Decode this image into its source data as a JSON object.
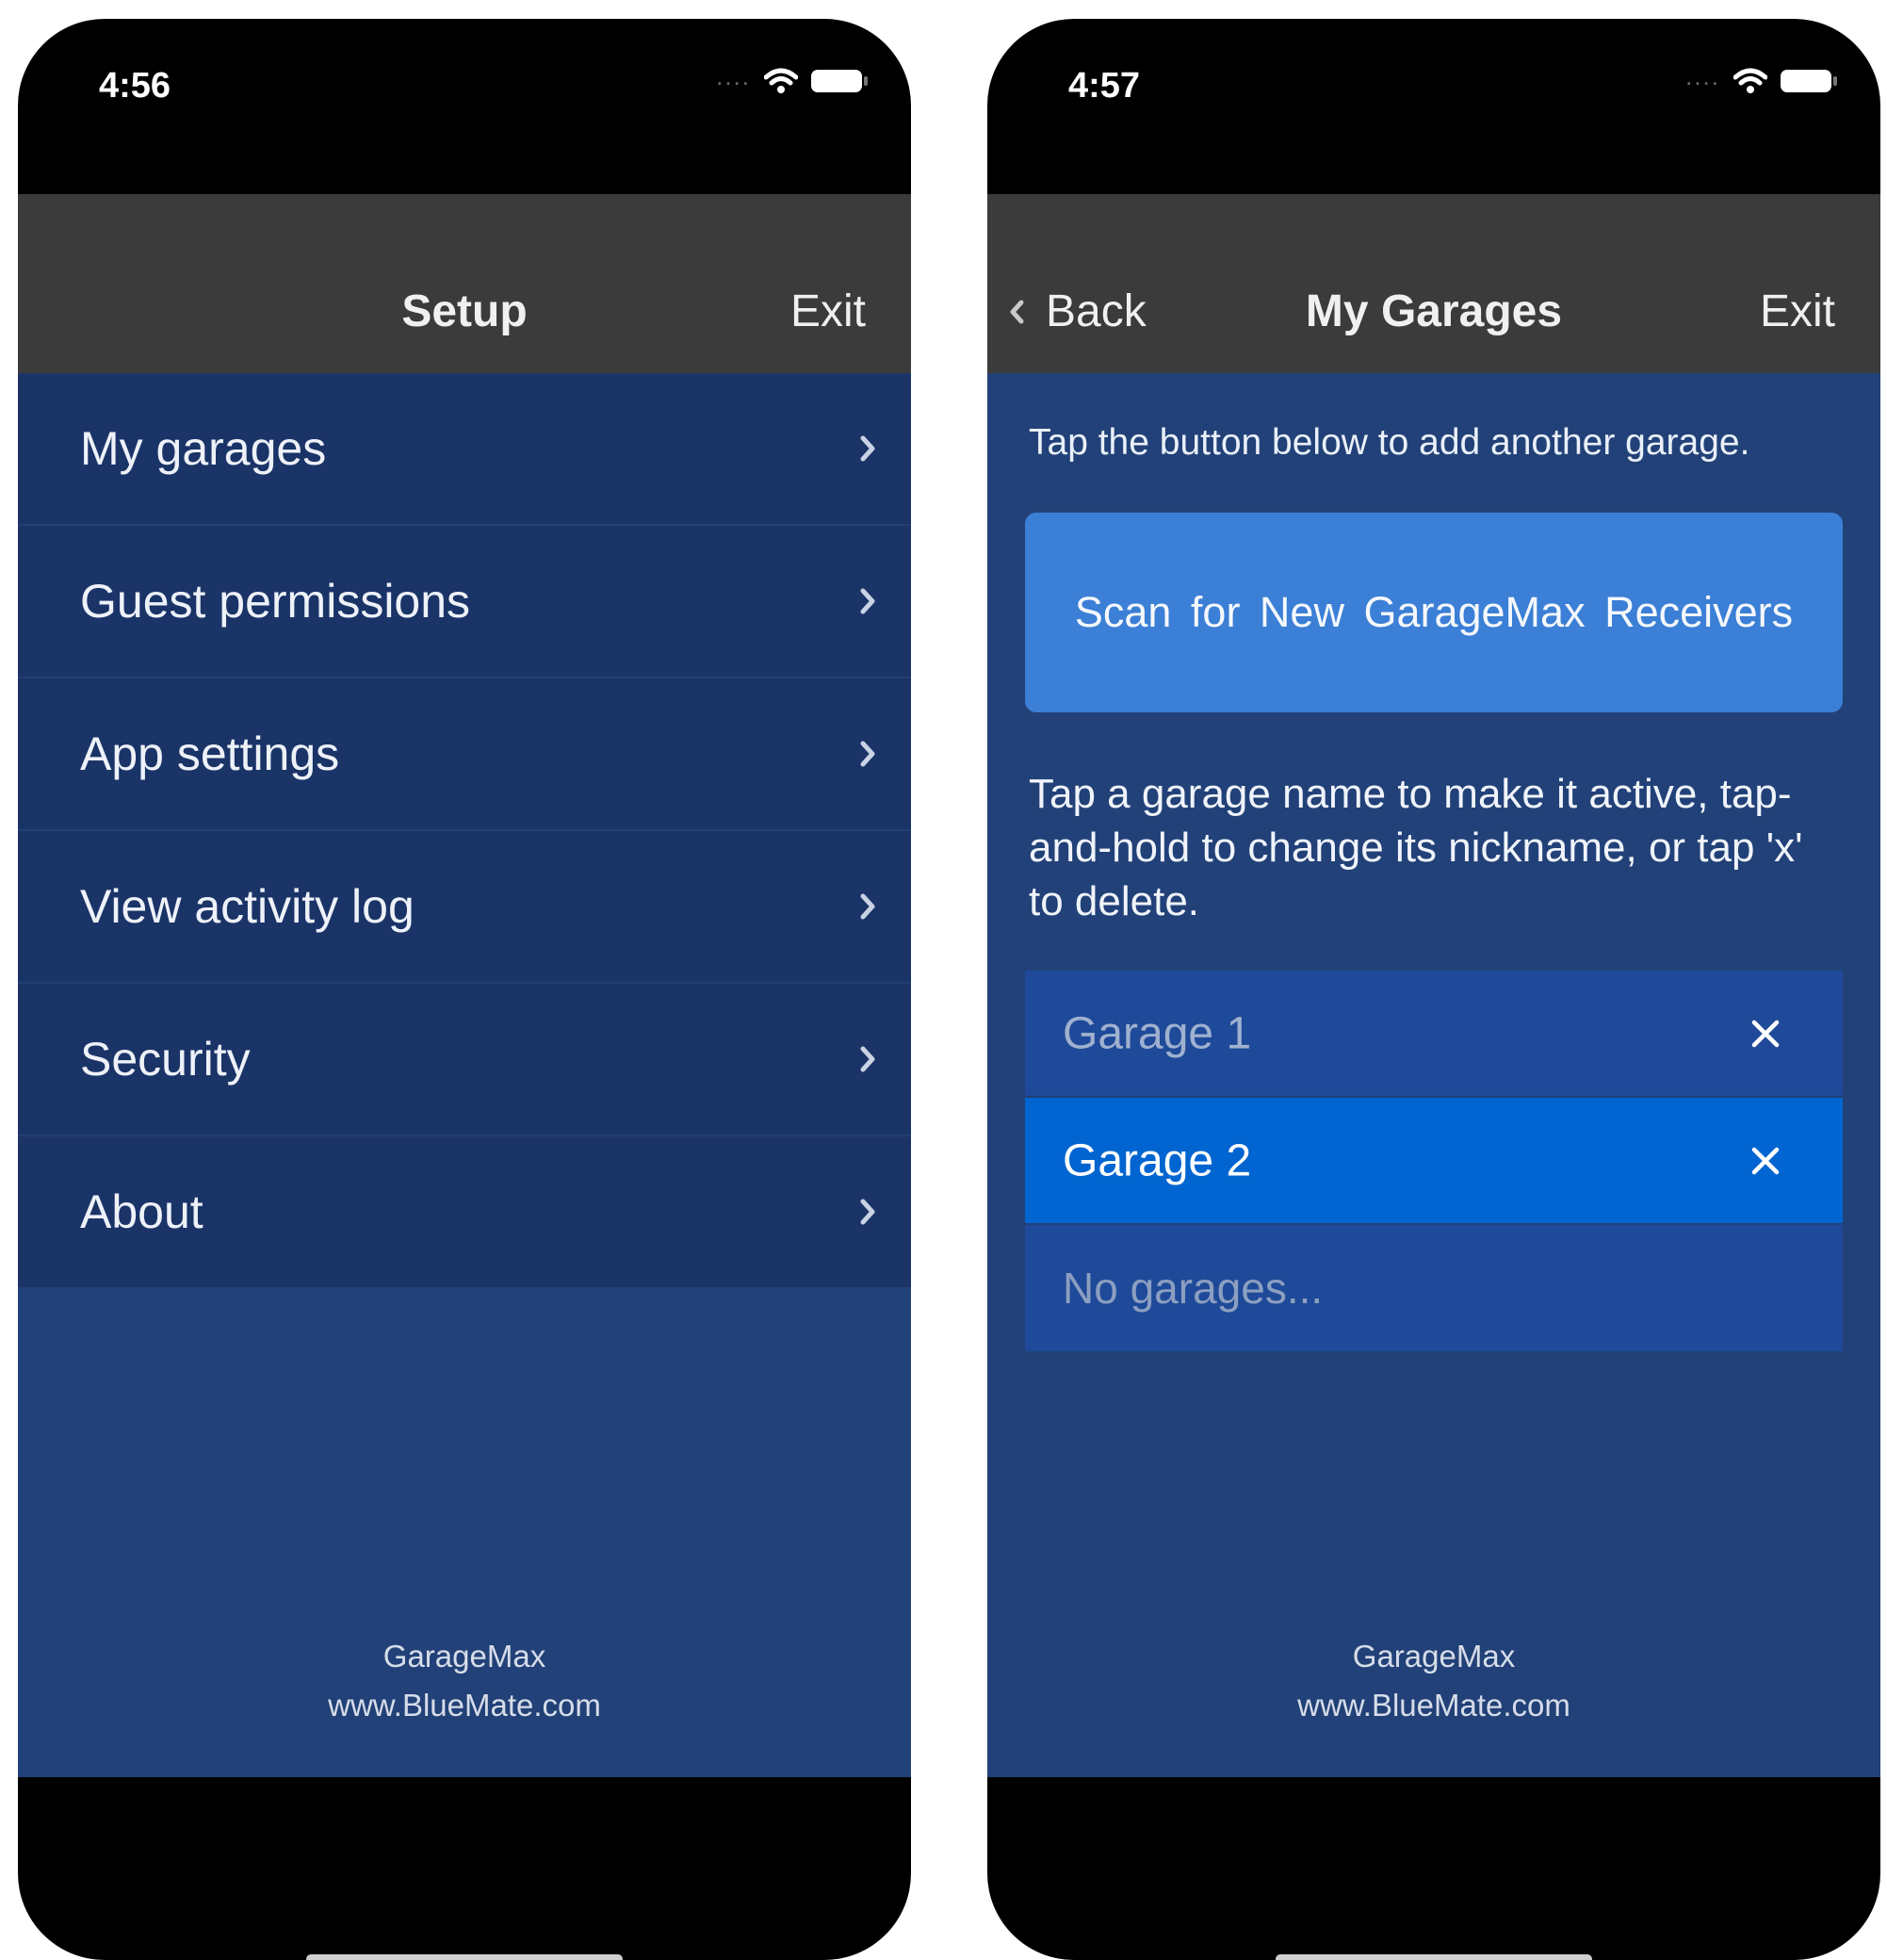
{
  "left_screen": {
    "status": {
      "time": "4:56"
    },
    "nav": {
      "title": "Setup",
      "exit_label": "Exit"
    },
    "menu": [
      {
        "label": "My garages"
      },
      {
        "label": "Guest permissions"
      },
      {
        "label": "App settings"
      },
      {
        "label": "View activity log"
      },
      {
        "label": "Security"
      },
      {
        "label": "About"
      }
    ],
    "footer": {
      "app_name": "GarageMax",
      "website": "www.BlueMate.com"
    }
  },
  "right_screen": {
    "status": {
      "time": "4:57"
    },
    "nav": {
      "back_label": "Back",
      "title": "My Garages",
      "exit_label": "Exit"
    },
    "intro_text": "Tap the button below to add another garage.",
    "scan_button_label": "Scan for New GarageMax Receivers",
    "instructions": "Tap a garage name to make it active, tap-and-hold to change its nickname, or tap 'x' to delete.",
    "garages": [
      {
        "name": "Garage 1",
        "active": false
      },
      {
        "name": "Garage 2",
        "active": true
      }
    ],
    "empty_text": "No garages...",
    "footer": {
      "app_name": "GarageMax",
      "website": "www.BlueMate.com"
    }
  },
  "colors": {
    "nav_bar": "#3b3b3c",
    "content_bg": "#224178",
    "menu_row_bg": "#1b3468",
    "scan_button": "#3b7fd6",
    "active_garage": "#0065d0",
    "inactive_garage": "#1f4a99"
  },
  "icons": [
    "wifi-icon",
    "battery-icon",
    "chevron-right-icon",
    "chevron-left-icon",
    "close-icon"
  ]
}
